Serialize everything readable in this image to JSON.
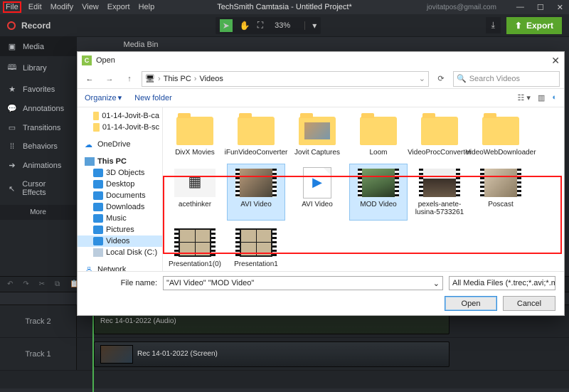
{
  "menubar": {
    "file": "File",
    "edit": "Edit",
    "modify": "Modify",
    "view": "View",
    "export": "Export",
    "help": "Help"
  },
  "title": "TechSmith Camtasia - Untitled Project*",
  "user_email": "jovitatpos@gmail.com",
  "record_label": "Record",
  "zoom_value": "33%",
  "export_label": "Export",
  "leftnav": {
    "media": "Media",
    "library": "Library",
    "favorites": "Favorites",
    "annotations": "Annotations",
    "transitions": "Transitions",
    "behaviors": "Behaviors",
    "animations": "Animations",
    "cursor_effects": "Cursor Effects",
    "more": "More"
  },
  "mediabin_title": "Media Bin",
  "timeline": {
    "track2": "Track 2",
    "track1": "Track 1",
    "clip_audio": "Rec 14-01-2022 (Audio)",
    "clip_video": "Rec 14-01-2022 (Screen)"
  },
  "dialog": {
    "title": "Open",
    "breadcrumb": {
      "pc": "This PC",
      "videos": "Videos"
    },
    "search_placeholder": "Search Videos",
    "organize": "Organize",
    "newfolder": "New folder",
    "tree": {
      "f1": "01-14-Jovit-B-ca",
      "f2": "01-14-Jovit-B-sc",
      "onedrive": "OneDrive",
      "thispc": "This PC",
      "obj3d": "3D Objects",
      "desktop": "Desktop",
      "documents": "Documents",
      "downloads": "Downloads",
      "music": "Music",
      "pictures": "Pictures",
      "videos": "Videos",
      "localdisk": "Local Disk (C:)",
      "network": "Network"
    },
    "files": {
      "divx": "DivX Movies",
      "ifun": "iFunVideoConverter",
      "jovit": "Jovit Captures",
      "loom": "Loom",
      "videoproc": "VideoProcConverter",
      "videoweb": "VideoWebDownloader",
      "acethinker": "acethinker",
      "avi1": "AVI Video",
      "avi2": "AVI Video",
      "mod": "MOD Video",
      "pexels": "pexels-anete-lusina-5733261",
      "poscast": "Poscast",
      "pres1": "Presentation1(0)",
      "pres2": "Presentation1"
    },
    "filename_label": "File name:",
    "filename_value": "\"AVI Video\" \"MOD Video\"",
    "filetype": "All Media Files (*.trec;*.avi;*.mp",
    "open": "Open",
    "cancel": "Cancel"
  }
}
